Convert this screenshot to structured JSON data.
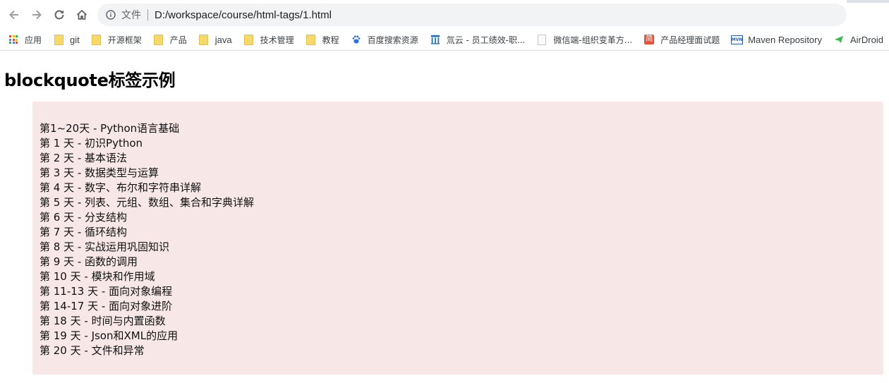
{
  "browser": {
    "omnibox": {
      "label": "文件",
      "url": "D:/workspace/course/html-tags/1.html"
    },
    "bookmarks": [
      {
        "label": "应用",
        "icon": "apps-grid-icon"
      },
      {
        "label": "git",
        "icon": "folder-icon"
      },
      {
        "label": "开源框架",
        "icon": "folder-icon"
      },
      {
        "label": "产品",
        "icon": "folder-icon"
      },
      {
        "label": "java",
        "icon": "folder-icon"
      },
      {
        "label": "技术管理",
        "icon": "folder-icon"
      },
      {
        "label": "教程",
        "icon": "folder-icon"
      },
      {
        "label": "百度搜索资源",
        "icon": "baidu-paw-icon"
      },
      {
        "label": "氚云 - 员工绩效-职...",
        "icon": "chuanyun-icon"
      },
      {
        "label": "微信端-组织变革方...",
        "icon": "page-icon"
      },
      {
        "label": "产品经理面试题",
        "icon": "jian-icon"
      },
      {
        "label": "Maven Repository",
        "icon": "mvn-icon"
      },
      {
        "label": "AirDroid",
        "icon": "airdroid-icon"
      }
    ],
    "icon_glyphs": {
      "jian": "简",
      "mvn": "MVN"
    }
  },
  "page": {
    "heading": "blockquote标签示例",
    "quote_lines": [
      "第1~20天 - Python语言基础",
      "第 1 天 - 初识Python",
      "第 2 天 - 基本语法",
      "第 3 天 - 数据类型与运算",
      "第 4 天 - 数字、布尔和字符串详解",
      "第 5 天 - 列表、元组、数组、集合和字典详解",
      "第 6 天 - 分支结构",
      "第 7 天 - 循环结构",
      "第 8 天 - 实战运用巩固知识",
      "第 9 天 - 函数的调用",
      "第 10 天 - 模块和作用域",
      "第 11-13 天 - 面向对象编程",
      "第 14-17 天 - 面向对象进阶",
      "第 18 天 - 时间与内置函数",
      "第 19 天 - Json和XML的应用",
      "第 20 天 - 文件和异常"
    ]
  },
  "colors": {
    "quote_background": "#f7e8e7",
    "omnibox_background": "#f1f3f4",
    "folder": "#f6d86b"
  }
}
